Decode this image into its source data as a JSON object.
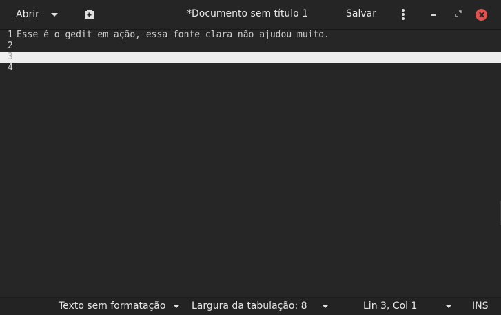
{
  "headerbar": {
    "open_label": "Abrir",
    "title": "*Documento sem título 1",
    "save_label": "Salvar"
  },
  "editor": {
    "lines": [
      {
        "number": "1",
        "text": "Esse é o gedit em ação, essa fonte clara não ajudou muito."
      },
      {
        "number": "2",
        "text": ""
      },
      {
        "number": "3",
        "text": ""
      },
      {
        "number": "4",
        "text": ""
      }
    ],
    "current_line": 3
  },
  "statusbar": {
    "syntax": "Texto sem formatação",
    "tab_width": "Largura da tabulação: 8",
    "position": "Lin 3, Col 1",
    "mode": "INS"
  },
  "colors": {
    "background": "#262626",
    "current_line": "#eeeeee",
    "close_button": "#e0524d",
    "text": "#e6e6e6"
  }
}
